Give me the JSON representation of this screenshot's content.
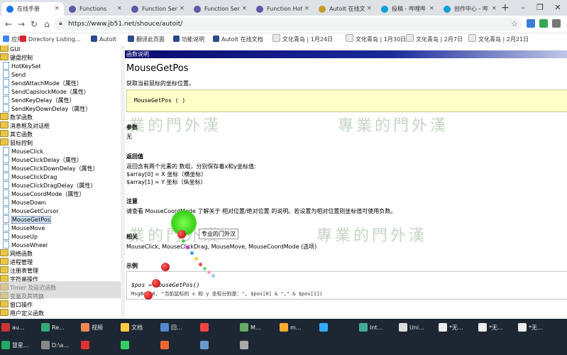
{
  "browser": {
    "tabs": [
      {
        "label": "在线手册",
        "fav": "#1a73e8"
      },
      {
        "label": "Functions",
        "fav": "#5a5aa8"
      },
      {
        "label": "Function Sen",
        "fav": "#5a5aa8"
      },
      {
        "label": "Function Sen",
        "fav": "#5a5aa8"
      },
      {
        "label": "Function Hot",
        "fav": "#5a5aa8"
      },
      {
        "label": "AutoIt 在线文",
        "fav": "#c89a2a"
      },
      {
        "label": "投稿 - 哔哩哔",
        "fav": "#00a1d6"
      },
      {
        "label": "创作中心 - 哔",
        "fav": "#00a1d6"
      }
    ],
    "url": "https://www.jb51.net/shouce/autoit/",
    "bookmarks": [
      "应用",
      "Directory Listing...",
      "AutoIt",
      "翻译此页面",
      "功能说明",
      "AutoIt 在线文档",
      "文化青岛 | 1月24日",
      "文化青岛 | 1月30日",
      "文化青岛 | 2月7日",
      "文化青岛 | 2月21日"
    ]
  },
  "sidebar": {
    "items": [
      {
        "label": "GUI",
        "type": "folder",
        "indent": 0
      },
      {
        "label": "键盘控制",
        "type": "folder",
        "indent": 0
      },
      {
        "label": "HotKeySet",
        "type": "page",
        "indent": 1
      },
      {
        "label": "Send",
        "type": "page",
        "indent": 1
      },
      {
        "label": "SendAttachMode（属性）",
        "type": "page",
        "indent": 1
      },
      {
        "label": "SendCapslockMode（属性）",
        "type": "page",
        "indent": 1
      },
      {
        "label": "SendKeyDelay（属性）",
        "type": "page",
        "indent": 1
      },
      {
        "label": "SendKeyDownDelay（属性）",
        "type": "page",
        "indent": 1
      },
      {
        "label": "数学函数",
        "type": "folder",
        "indent": 0
      },
      {
        "label": "消息框及对话框",
        "type": "folder",
        "indent": 0
      },
      {
        "label": "其它函数",
        "type": "folder",
        "indent": 0
      },
      {
        "label": "鼠标控制",
        "type": "folder",
        "indent": 0
      },
      {
        "label": "MouseClick",
        "type": "page",
        "indent": 1
      },
      {
        "label": "MouseClickDelay（属性）",
        "type": "page",
        "indent": 1
      },
      {
        "label": "MouseClickDownDelay（属性）",
        "type": "page",
        "indent": 1
      },
      {
        "label": "MouseClickDrag",
        "type": "page",
        "indent": 1
      },
      {
        "label": "MouseClickDragDelay（属性）",
        "type": "page",
        "indent": 1
      },
      {
        "label": "MouseCoordMode（属性）",
        "type": "page",
        "indent": 1
      },
      {
        "label": "MouseDown",
        "type": "page",
        "indent": 1
      },
      {
        "label": "MouseGetCursor",
        "type": "page",
        "indent": 1
      },
      {
        "label": "MouseGetPos",
        "type": "page",
        "indent": 1,
        "selected": true
      },
      {
        "label": "MouseMove",
        "type": "page",
        "indent": 1
      },
      {
        "label": "MouseUp",
        "type": "page",
        "indent": 1
      },
      {
        "label": "MouseWheel",
        "type": "page",
        "indent": 1
      },
      {
        "label": "网络函数",
        "type": "folder",
        "indent": 0
      },
      {
        "label": "进程管理",
        "type": "folder",
        "indent": 0
      },
      {
        "label": "注册表管理",
        "type": "folder",
        "indent": 0
      },
      {
        "label": "字符串操作",
        "type": "folder",
        "indent": 0
      },
      {
        "label": "Timer 及延迟函数",
        "type": "folder",
        "indent": 0
      },
      {
        "label": "变量及其转换",
        "type": "folder",
        "indent": 0
      },
      {
        "label": "窗口操作",
        "type": "folder",
        "indent": 0
      },
      {
        "label": "用户定义函数",
        "type": "folder",
        "indent": 0
      }
    ]
  },
  "doc": {
    "section": "函数说明",
    "title": "MouseGetPos",
    "desc": "获取当前鼠标的坐标位置。",
    "syntax": "MouseGetPos ( )",
    "params_heading": "参数",
    "params_body": "无",
    "return_heading": "返回值",
    "return_lines": [
      "返回含有两个元素的 数组，分别保存着x和y坐标值:",
      "$array[0] = X 坐标（横坐标）",
      "$array[1] = Y 坐标（纵坐标）"
    ],
    "notes_heading": "注意",
    "notes_body": "请查看 MouseCoordMode 了解关于 相对位置/绝对位置 的说明。若设置为相对位置则坐标值可使用负数。",
    "related_heading": "相关",
    "related_body": "MouseClick, MouseClickDrag, MouseMove, MouseCoordMode (选项)",
    "example_heading": "示例",
    "example_line1": "$pos = MouseGetPos()",
    "example_line2": "MsgBox(0, \"当前鼠标的 x 和 y 坐标分别是：\", $pos[0] & \",\" & $pos[1])"
  },
  "overlay": {
    "watermark": "專業的門外漢",
    "tooltip": "专业的门外汉"
  },
  "taskbar": {
    "items": [
      "au...",
      "Re...",
      "视频",
      "文档",
      "回...",
      "",
      "M...",
      "m...",
      "",
      "Int...",
      "Uni...",
      "*无...",
      "*无...",
      "*无...",
      "慧星...",
      "D:\\a...",
      "",
      "",
      "",
      "",
      ""
    ]
  }
}
